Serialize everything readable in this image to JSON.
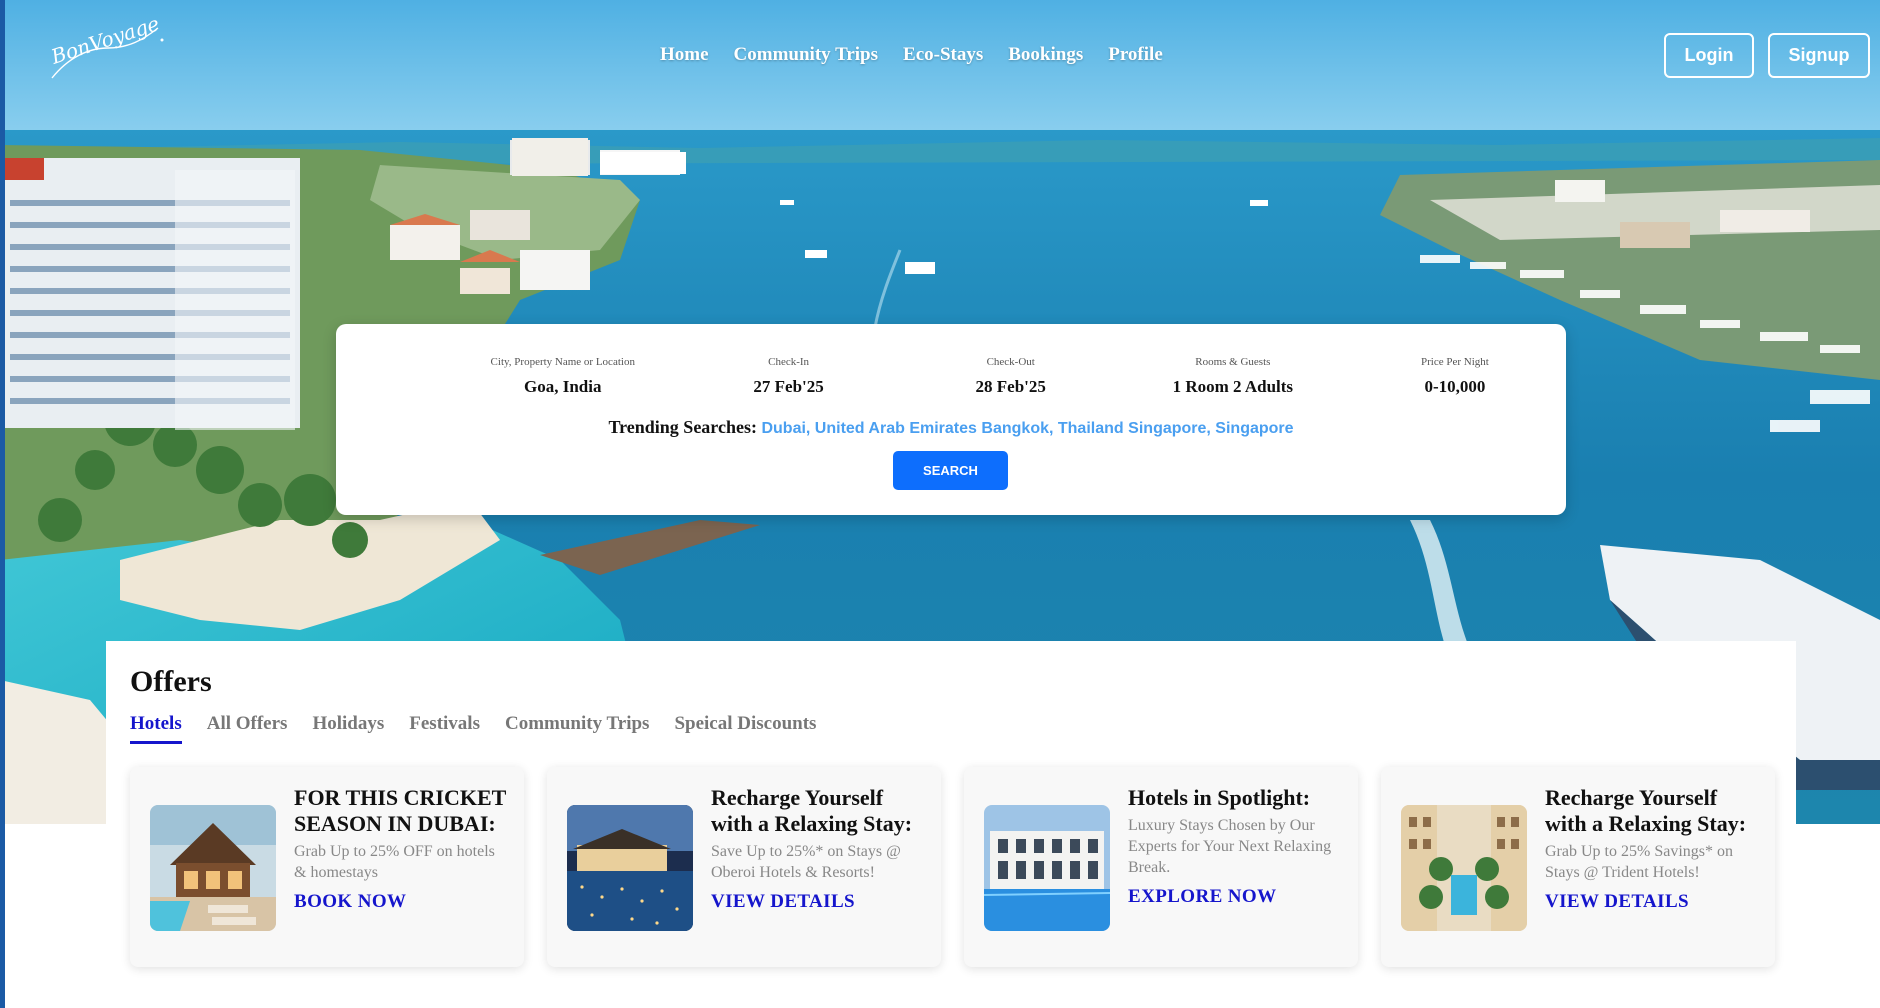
{
  "brand": {
    "logo_text": "BonVoyage"
  },
  "nav": {
    "items": [
      {
        "label": "Home"
      },
      {
        "label": "Community Trips"
      },
      {
        "label": "Eco-Stays"
      },
      {
        "label": "Bookings"
      },
      {
        "label": "Profile"
      }
    ],
    "login_label": "Login",
    "signup_label": "Signup"
  },
  "search": {
    "fields": [
      {
        "label": "City, Property Name or Location",
        "value": "Goa, India"
      },
      {
        "label": "Check-In",
        "value": "27 Feb'25"
      },
      {
        "label": "Check-Out",
        "value": "28 Feb'25"
      },
      {
        "label": "Rooms & Guests",
        "value": "1 Room 2 Adults"
      },
      {
        "label": "Price Per Night",
        "value": "0-10,000"
      }
    ],
    "trending_label": "Trending Searches:",
    "trending": [
      "Dubai, United Arab Emirates",
      "Bangkok, Thailand",
      "Singapore, Singapore"
    ],
    "button_label": "SEARCH"
  },
  "offers": {
    "title": "Offers",
    "tabs": [
      "Hotels",
      "All Offers",
      "Holidays",
      "Festivals",
      "Community Trips",
      "Speical Discounts"
    ],
    "active_tab": "Hotels",
    "cards": [
      {
        "title": "FOR THIS CRICKET SEASON IN DUBAI:",
        "desc": "Grab Up to 25% OFF on hotels & homestays",
        "cta": "BOOK NOW",
        "image": "dubai-lodge-pool"
      },
      {
        "title": "Recharge Yourself with a Relaxing Stay:",
        "desc": "Save Up to 25%* on Stays @ Oberoi Hotels & Resorts!",
        "cta": "VIEW DETAILS",
        "image": "oberoi-night-pool"
      },
      {
        "title": "Hotels in Spotlight:",
        "desc": "Luxury Stays Chosen by Our Experts for Your Next Relaxing Break.",
        "cta": "EXPLORE NOW",
        "image": "luxury-hotel-pool"
      },
      {
        "title": "Recharge Yourself with a Relaxing Stay:",
        "desc": "Grab Up to 25% Savings* on Stays @ Trident Hotels!",
        "cta": "VIEW DETAILS",
        "image": "trident-courtyard-pool"
      }
    ]
  },
  "colors": {
    "accent": "#0d6efd",
    "tab_active": "#1515cc",
    "trending_link": "#4a9ff0",
    "sea": "#1d7fb0"
  }
}
